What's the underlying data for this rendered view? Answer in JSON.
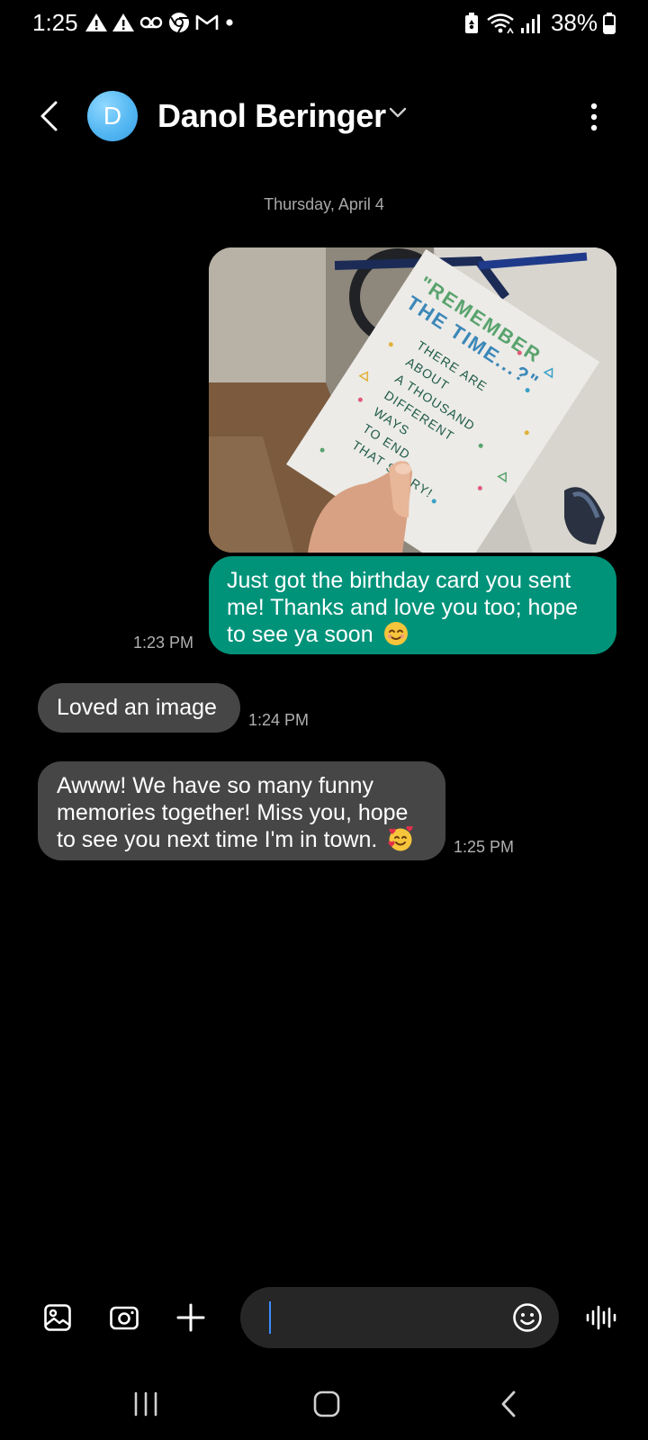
{
  "status_bar": {
    "time": "1:25",
    "battery": "38%",
    "left_icons": [
      "warning-icon",
      "warning-icon",
      "voicemail-icon",
      "chrome-icon",
      "gmail-icon",
      "dot-icon"
    ],
    "right_icons": [
      "battery-saver-icon",
      "wifi-icon",
      "signal-icon",
      "battery-icon"
    ]
  },
  "header": {
    "avatar_initial": "D",
    "contact_name": "Danol Beringer",
    "avatar_color": "#55b8f2"
  },
  "conversation": {
    "date_label": "Thursday, April 4",
    "messages": [
      {
        "direction": "outgoing",
        "attachment": "photo",
        "text": "Just got the birthday card you sent me! Thanks and love you too; hope to see ya soon",
        "emoji": "smiling-face-icon",
        "time": "1:23 PM"
      },
      {
        "direction": "incoming",
        "text": "Loved an image",
        "time": "1:24 PM"
      },
      {
        "direction": "incoming",
        "text": "Awww! We have so many funny memories together! Miss you, hope to see you next time I'm in town.",
        "emoji": "smiling-face-with-hearts-icon",
        "time": "1:25 PM"
      }
    ]
  },
  "photo_card": {
    "headline_1": "\"REMEMBER",
    "headline_2": "THE TIME...?\"",
    "lines": [
      "THERE ARE",
      "ABOUT",
      "A THOUSAND",
      "DIFFERENT",
      "WAYS",
      "TO END",
      "THAT STORY!"
    ]
  },
  "composer": {
    "placeholder": "",
    "value": ""
  },
  "colors": {
    "background": "#000000",
    "outgoing_bubble": "#00937a",
    "incoming_bubble": "#464646",
    "timestamp": "#b0b0b0",
    "input_background": "#262626"
  }
}
